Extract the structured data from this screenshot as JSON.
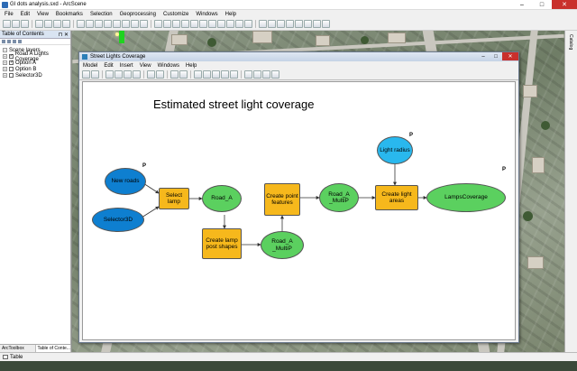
{
  "app": {
    "title": "GI dots analysis.sxd - ArcScene",
    "window_buttons": [
      "–",
      "□",
      "✕"
    ],
    "menu": [
      "File",
      "Edit",
      "View",
      "Bookmarks",
      "Selection",
      "Geoprocessing",
      "Customize",
      "Windows",
      "Help"
    ]
  },
  "toc": {
    "title": "Table of Contents",
    "pin": "⊓ ✕",
    "root": "Scene layers",
    "layers": [
      {
        "label": "Road A Lights Coverage",
        "checked": true
      },
      {
        "label": "Option A",
        "checked": true
      },
      {
        "label": "Option B",
        "checked": false
      },
      {
        "label": "Selector3D",
        "checked": false
      }
    ],
    "tabs": [
      "ArcToolbox",
      "Table of Conte..."
    ]
  },
  "status": {
    "label": "Table"
  },
  "right_dock": {
    "label": "Catalog"
  },
  "model_window": {
    "title": "Street Lights Coverage",
    "menu": [
      "Model",
      "Edit",
      "Insert",
      "View",
      "Windows",
      "Help"
    ]
  },
  "model": {
    "heading": "Estimated street light coverage",
    "param_marker": "P",
    "nodes": {
      "new_roads": "New roads",
      "selector3d": "Selector3D",
      "select_lamp": "Select lamp",
      "road_a": "Road_A",
      "create_lamp_post": "Create lamp post shapes",
      "road_a_multip_1": "Road_A _MultiP",
      "create_point_features": "Create point features",
      "road_a_multip_2": "Road_A _MultiP",
      "light_radius": "Light radius",
      "create_light_areas": "Create light areas",
      "lamps_coverage": "LampsCoverage"
    }
  },
  "colors": {
    "input_data": "#0e7fd0",
    "parameter": "#29b8ee",
    "tool": "#f6b81c",
    "derived_data": "#5bd05f"
  }
}
